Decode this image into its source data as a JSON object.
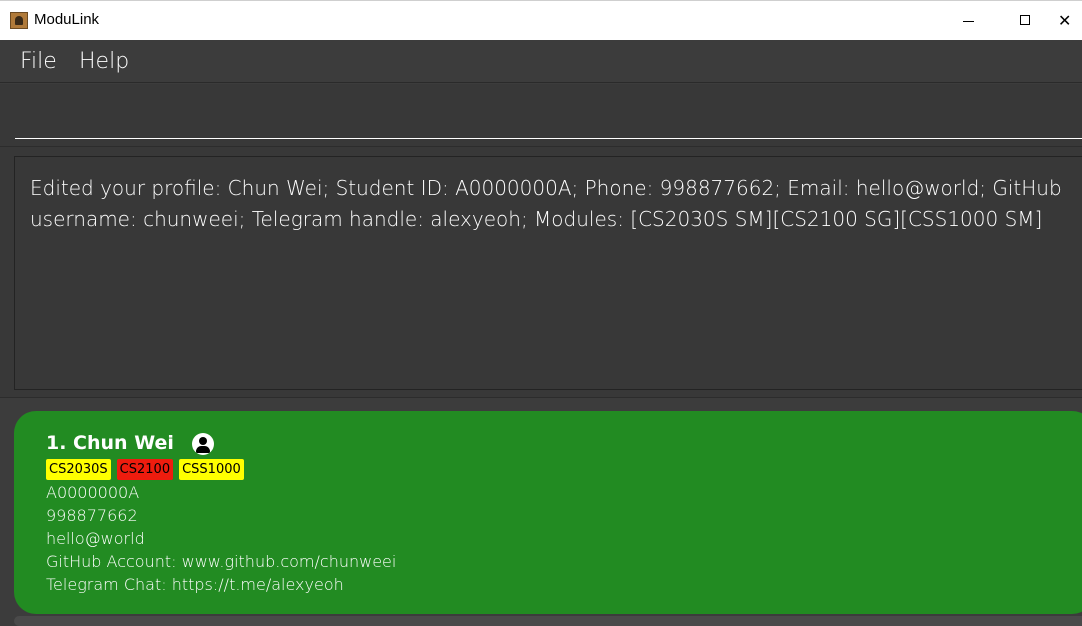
{
  "window": {
    "title": "ModuLink",
    "app_icon": "address-book-icon",
    "controls": {
      "minimize": "minimize-icon",
      "maximize": "maximize-icon",
      "close": "close-icon"
    },
    "close_glyph": "✕"
  },
  "menu": {
    "file": "File",
    "help": "Help"
  },
  "command": {
    "value": "",
    "placeholder": ""
  },
  "result": {
    "text": "Edited your profile: Chun Wei; Student ID: A0000000A; Phone: 998877662; Email: hello@world; GitHub username: chunweei; Telegram handle: alexyeoh; Modules: [CS2030S SM][CS2100 SG][CSS1000 SM]"
  },
  "persons": [
    {
      "index_name": "1. Chun Wei",
      "icon": "profile-icon",
      "tags": [
        {
          "label": "CS2030S",
          "color": "#ffff00"
        },
        {
          "label": "CS2100",
          "color": "#ee1c0e"
        },
        {
          "label": "CSS1000",
          "color": "#ffff00"
        }
      ],
      "student_id": "A0000000A",
      "phone": "998877662",
      "email": "hello@world",
      "github": "GitHub Account: www.github.com/chunweei",
      "telegram": "Telegram Chat: https://t.me/alexyeoh",
      "card_color": "#228b22"
    }
  ],
  "colors": {
    "background": "#3c3c3c",
    "pane": "#383838",
    "text": "#ffffff"
  }
}
